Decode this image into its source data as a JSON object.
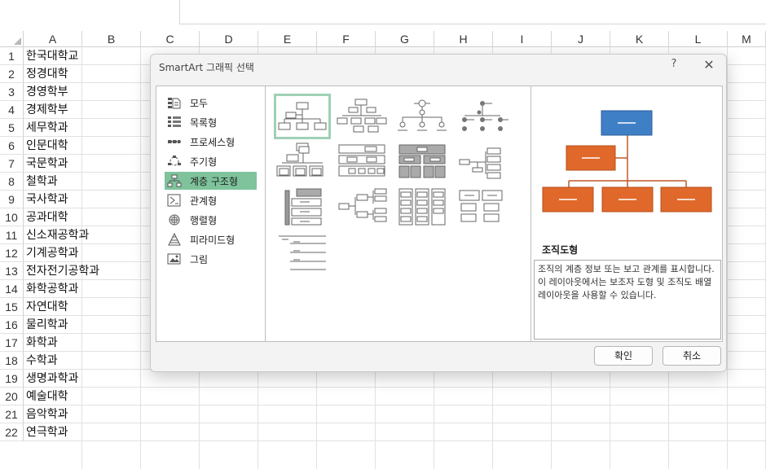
{
  "spreadsheet": {
    "columns": [
      "A",
      "B",
      "C",
      "D",
      "E",
      "F",
      "G",
      "H",
      "I",
      "J",
      "K",
      "L",
      "M"
    ],
    "rows": [
      "1",
      "2",
      "3",
      "4",
      "5",
      "6",
      "7",
      "8",
      "9",
      "10",
      "11",
      "12",
      "13",
      "14",
      "15",
      "16",
      "17",
      "18",
      "19",
      "20",
      "21",
      "22"
    ],
    "column_a": [
      "한국대학교",
      "정경대학",
      "경영학부",
      "경제학부",
      "세무학과",
      "인문대학",
      "국문학과",
      "철학과",
      "국사학과",
      "공과대학",
      "신소재공학과",
      "기계공학과",
      "전자전기공학과",
      "화학공학과",
      "자연대학",
      "물리학과",
      "화학과",
      "수학과",
      "생명과학과",
      "예술대학",
      "음악학과",
      "연극학과"
    ]
  },
  "dialog": {
    "title": "SmartArt 그래픽 선택",
    "help": "?",
    "close": "✕",
    "categories": [
      {
        "label": "모두",
        "icon": "all-icon"
      },
      {
        "label": "목록형",
        "icon": "list-icon"
      },
      {
        "label": "프로세스형",
        "icon": "process-icon"
      },
      {
        "label": "주기형",
        "icon": "cycle-icon"
      },
      {
        "label": "계층 구조형",
        "icon": "hierarchy-icon",
        "selected": true
      },
      {
        "label": "관계형",
        "icon": "relationship-icon"
      },
      {
        "label": "행렬형",
        "icon": "matrix-icon"
      },
      {
        "label": "피라미드형",
        "icon": "pyramid-icon"
      },
      {
        "label": "그림",
        "icon": "picture-icon"
      }
    ],
    "preview": {
      "name": "조직도형",
      "description": "조직의 계층 정보 또는 보고 관계를 표시합니다. 이 레이아웃에서는 보조자 도형 및 조직도 배열 레이아웃을 사용할 수 있습니다.",
      "colors": {
        "top": "#3f7fc6",
        "middle": "#e0682a",
        "connector": "#c0582a"
      }
    },
    "ok_label": "확인",
    "cancel_label": "취소"
  }
}
